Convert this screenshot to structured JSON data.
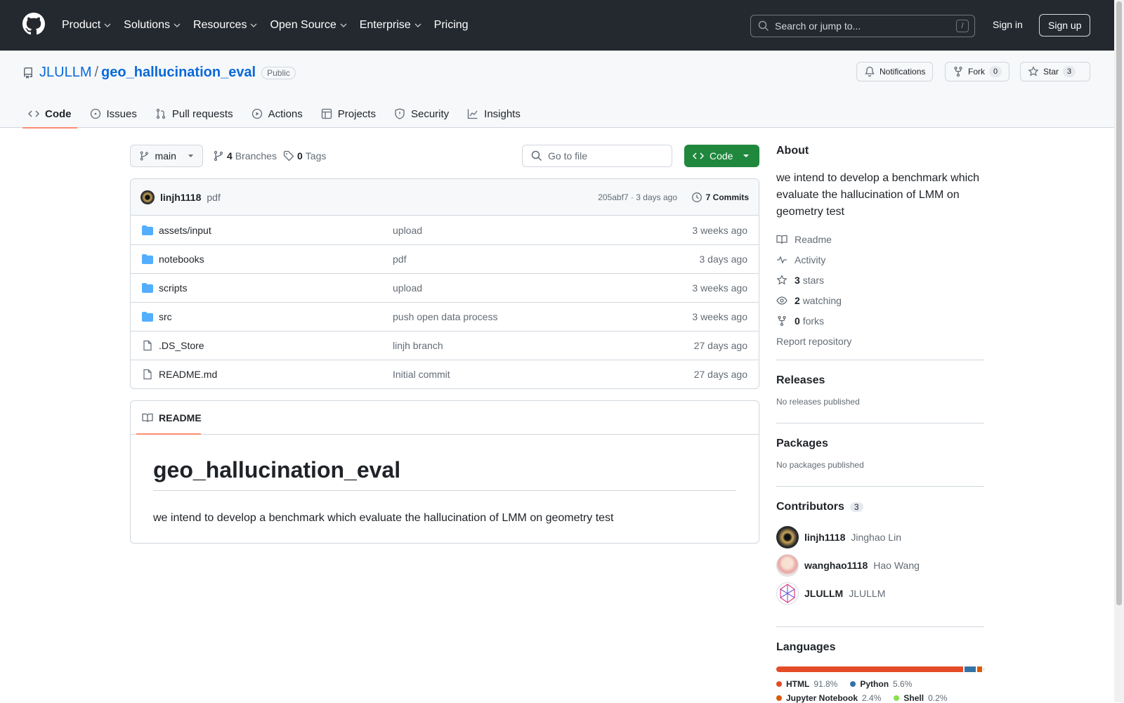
{
  "topnav": {
    "items": [
      {
        "label": "Product"
      },
      {
        "label": "Solutions"
      },
      {
        "label": "Resources"
      },
      {
        "label": "Open Source"
      },
      {
        "label": "Enterprise"
      },
      {
        "label": "Pricing"
      }
    ],
    "search_placeholder": "Search or jump to...",
    "search_shortcut": "/",
    "signin": "Sign in",
    "signup": "Sign up"
  },
  "repo": {
    "owner": "JLULLM",
    "separator": "/",
    "name": "geo_hallucination_eval",
    "visibility": "Public",
    "notifications": "Notifications",
    "fork_label": "Fork",
    "fork_count": "0",
    "star_label": "Star",
    "star_count": "3"
  },
  "tabs": [
    {
      "label": "Code",
      "active": true
    },
    {
      "label": "Issues"
    },
    {
      "label": "Pull requests"
    },
    {
      "label": "Actions"
    },
    {
      "label": "Projects"
    },
    {
      "label": "Security"
    },
    {
      "label": "Insights"
    }
  ],
  "toolbar": {
    "branch": "main",
    "branches_count": "4",
    "branches_label": "Branches",
    "tags_count": "0",
    "tags_label": "Tags",
    "gofile_placeholder": "Go to file",
    "code_label": "Code"
  },
  "commit": {
    "user": "linjh1118",
    "message": "pdf",
    "hash_time": "205abf7 · 3 days ago",
    "commits_label": "7 Commits"
  },
  "files": [
    {
      "name": "assets/input",
      "type": "dir",
      "message": "upload",
      "date": "3 weeks ago"
    },
    {
      "name": "notebooks",
      "type": "dir",
      "message": "pdf",
      "date": "3 days ago"
    },
    {
      "name": "scripts",
      "type": "dir",
      "message": "upload",
      "date": "3 weeks ago"
    },
    {
      "name": "src",
      "type": "dir",
      "message": "push open data process",
      "date": "3 weeks ago"
    },
    {
      "name": ".DS_Store",
      "type": "file",
      "message": "linjh branch",
      "date": "27 days ago"
    },
    {
      "name": "README.md",
      "type": "file",
      "message": "Initial commit",
      "date": "27 days ago"
    }
  ],
  "readme": {
    "tab_label": "README",
    "title": "geo_hallucination_eval",
    "body": "we intend to develop a benchmark which evaluate the hallucination of LMM on geometry test"
  },
  "about": {
    "heading": "About",
    "description": "we intend to develop a benchmark which evaluate the hallucination of LMM on geometry test",
    "readme": "Readme",
    "activity": "Activity",
    "stars_count": "3",
    "stars_label": "stars",
    "watching_count": "2",
    "watching_label": "watching",
    "forks_count": "0",
    "forks_label": "forks",
    "report": "Report repository"
  },
  "releases": {
    "heading": "Releases",
    "text": "No releases published"
  },
  "packages": {
    "heading": "Packages",
    "text": "No packages published"
  },
  "contributors": {
    "heading": "Contributors",
    "count": "3",
    "items": [
      {
        "login": "linjh1118",
        "name": "Jinghao Lin"
      },
      {
        "login": "wanghao1118",
        "name": "Hao Wang"
      },
      {
        "login": "JLULLM",
        "name": "JLULLM"
      }
    ]
  },
  "languages": {
    "heading": "Languages",
    "items": [
      {
        "name": "HTML",
        "percent": "91.8%",
        "value": 91.8,
        "color": "#e34c26"
      },
      {
        "name": "Python",
        "percent": "5.6%",
        "value": 5.6,
        "color": "#3572A5"
      },
      {
        "name": "Jupyter Notebook",
        "percent": "2.4%",
        "value": 2.4,
        "color": "#DA5B0B"
      },
      {
        "name": "Shell",
        "percent": "0.2%",
        "value": 0.2,
        "color": "#89e051"
      }
    ]
  },
  "colors": {
    "accent": "#0969da",
    "green": "#1f883d",
    "underline": "#fd8c73",
    "header_bg": "#24292f"
  }
}
